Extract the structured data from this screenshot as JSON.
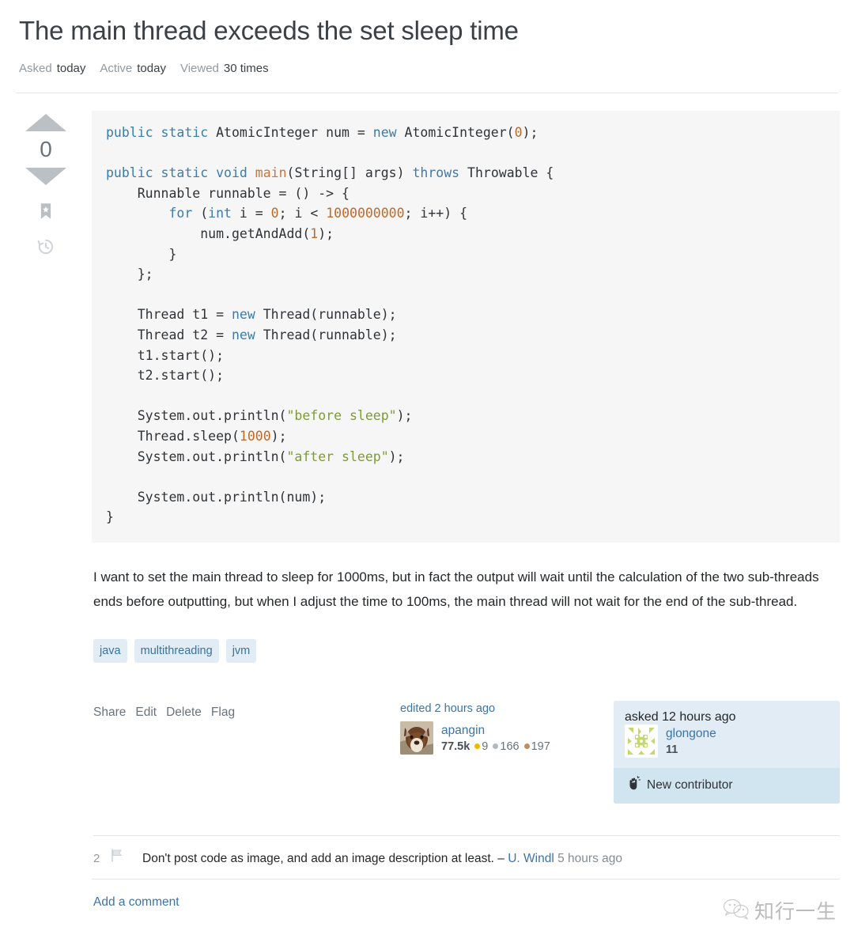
{
  "question": {
    "title": "The main thread exceeds the set sleep time",
    "meta": [
      {
        "label": "Asked",
        "value": "today"
      },
      {
        "label": "Active",
        "value": "today"
      },
      {
        "label": "Viewed",
        "value": "30 times"
      }
    ],
    "vote_score": "0",
    "body": "I want to set the main thread to sleep for 1000ms, but in fact the output will wait until the calculation of the two sub-threads ends before outputting, but when I adjust the time to 100ms, the main thread will not wait for the end of the sub-thread.",
    "tags": [
      "java",
      "multithreading",
      "jvm"
    ],
    "actions": [
      "Share",
      "Edit",
      "Delete",
      "Flag"
    ]
  },
  "code": {
    "language": "java",
    "lines": [
      [
        {
          "t": "public",
          "c": "k"
        },
        {
          "t": " ",
          "c": ""
        },
        {
          "t": "static",
          "c": "k"
        },
        {
          "t": " AtomicInteger num = ",
          "c": ""
        },
        {
          "t": "new",
          "c": "k"
        },
        {
          "t": " AtomicInteger(",
          "c": ""
        },
        {
          "t": "0",
          "c": "num"
        },
        {
          "t": ");",
          "c": ""
        }
      ],
      [
        {
          "t": "",
          "c": ""
        }
      ],
      [
        {
          "t": "public",
          "c": "k"
        },
        {
          "t": " ",
          "c": ""
        },
        {
          "t": "static",
          "c": "k"
        },
        {
          "t": " ",
          "c": ""
        },
        {
          "t": "void",
          "c": "k"
        },
        {
          "t": " ",
          "c": ""
        },
        {
          "t": "main",
          "c": "fn"
        },
        {
          "t": "(String[] args) ",
          "c": ""
        },
        {
          "t": "throws",
          "c": "k"
        },
        {
          "t": " Throwable {",
          "c": ""
        }
      ],
      [
        {
          "t": "    Runnable runnable = () -> {",
          "c": ""
        }
      ],
      [
        {
          "t": "        ",
          "c": ""
        },
        {
          "t": "for",
          "c": "k"
        },
        {
          "t": " (",
          "c": ""
        },
        {
          "t": "int",
          "c": "k"
        },
        {
          "t": " i = ",
          "c": ""
        },
        {
          "t": "0",
          "c": "num"
        },
        {
          "t": "; i < ",
          "c": ""
        },
        {
          "t": "1000000000",
          "c": "num"
        },
        {
          "t": "; i++) {",
          "c": ""
        }
      ],
      [
        {
          "t": "            num.getAndAdd(",
          "c": ""
        },
        {
          "t": "1",
          "c": "num"
        },
        {
          "t": ");",
          "c": ""
        }
      ],
      [
        {
          "t": "        }",
          "c": ""
        }
      ],
      [
        {
          "t": "    };",
          "c": ""
        }
      ],
      [
        {
          "t": "",
          "c": ""
        }
      ],
      [
        {
          "t": "    Thread t1 = ",
          "c": ""
        },
        {
          "t": "new",
          "c": "k"
        },
        {
          "t": " Thread(runnable);",
          "c": ""
        }
      ],
      [
        {
          "t": "    Thread t2 = ",
          "c": ""
        },
        {
          "t": "new",
          "c": "k"
        },
        {
          "t": " Thread(runnable);",
          "c": ""
        }
      ],
      [
        {
          "t": "    t1.start();",
          "c": ""
        }
      ],
      [
        {
          "t": "    t2.start();",
          "c": ""
        }
      ],
      [
        {
          "t": "",
          "c": ""
        }
      ],
      [
        {
          "t": "    System.out.println(",
          "c": ""
        },
        {
          "t": "\"before sleep\"",
          "c": "str"
        },
        {
          "t": ");",
          "c": ""
        }
      ],
      [
        {
          "t": "    Thread.sleep(",
          "c": ""
        },
        {
          "t": "1000",
          "c": "num"
        },
        {
          "t": ");",
          "c": ""
        }
      ],
      [
        {
          "t": "    System.out.println(",
          "c": ""
        },
        {
          "t": "\"after sleep\"",
          "c": "str"
        },
        {
          "t": ");",
          "c": ""
        }
      ],
      [
        {
          "t": "",
          "c": ""
        }
      ],
      [
        {
          "t": "    System.out.println(num);",
          "c": ""
        }
      ],
      [
        {
          "t": "}",
          "c": ""
        }
      ]
    ]
  },
  "editor": {
    "when": "edited 2 hours ago",
    "name": "apangin",
    "reputation": "77.5k",
    "badges": {
      "gold": "9",
      "silver": "166",
      "bronze": "197"
    }
  },
  "asker": {
    "when": "asked 12 hours ago",
    "name": "glongone",
    "reputation": "11",
    "new_contributor_label": "New contributor"
  },
  "comments": [
    {
      "score": "2",
      "text": "Don't post code as image, and add an image description at least.",
      "dash": "–",
      "user": "U. Windl",
      "when": "5 hours ago"
    }
  ],
  "add_comment_label": "Add a comment",
  "watermark": {
    "text": "知行一生"
  },
  "colors": {
    "link": "#3b74a8",
    "tag_bg": "#e1ecf4",
    "tag_fg": "#39739d",
    "code_bg": "#f6f6f6",
    "keyword": "#3b7ca8",
    "string": "#7f9a39",
    "number": "#bf6a28",
    "gold": "#f1b600",
    "silver": "#b4b8bc",
    "bronze": "#c28e5e",
    "asker_card_bg": "#e1ecf4",
    "new_contributor_bg": "#d1e5f1"
  }
}
